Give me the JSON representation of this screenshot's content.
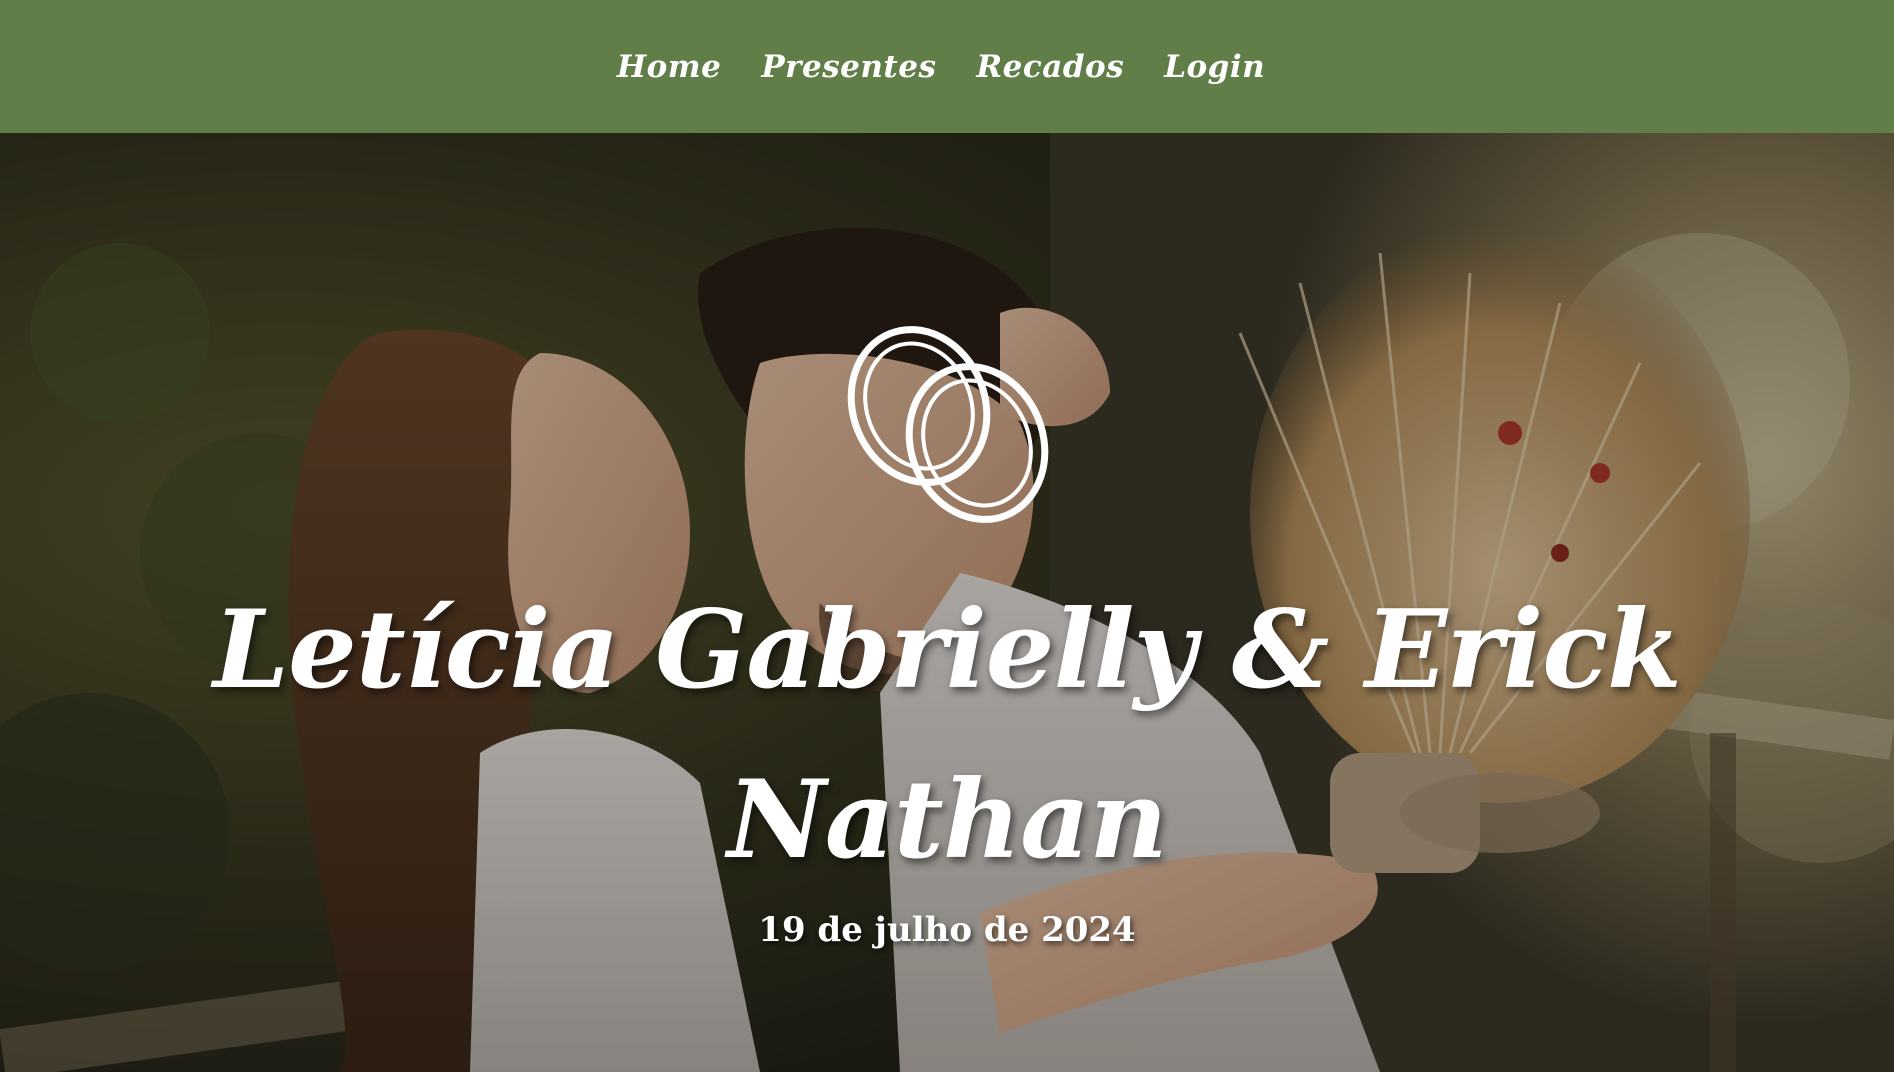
{
  "nav": {
    "items": [
      {
        "label": "Home"
      },
      {
        "label": "Presentes"
      },
      {
        "label": "Recados"
      },
      {
        "label": "Login"
      }
    ]
  },
  "hero": {
    "icon": "wedding-rings-icon",
    "title": "Letícia Gabrielly & Erick Nathan",
    "date": "19 de julho de 2024"
  },
  "colors": {
    "nav_background": "#617e49",
    "text": "#ffffff"
  }
}
